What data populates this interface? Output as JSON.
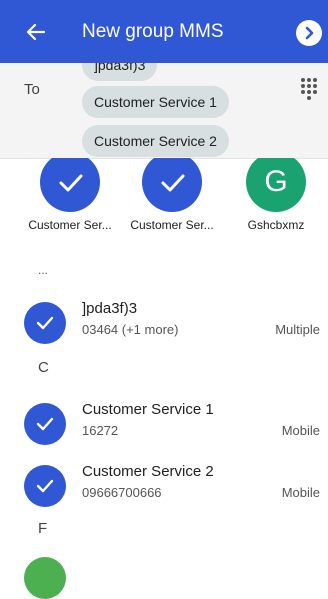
{
  "header": {
    "title": "New group MMS",
    "back_icon": "arrow-back-icon",
    "next_icon": "chevron-right-icon"
  },
  "recipients": {
    "to_label": "To",
    "chips": [
      "]pda3f)3",
      "Customer Service 1",
      "Customer Service 2"
    ],
    "dialpad_icon": "dialpad-icon"
  },
  "selected": [
    {
      "label": "Customer Ser...",
      "avatar": "check"
    },
    {
      "label": "Customer Ser...",
      "avatar": "check"
    },
    {
      "label": "Gshcbxmz",
      "avatar": "G"
    }
  ],
  "list": {
    "overflow_marker": "...",
    "sections": [
      {
        "letter": "",
        "contacts": [
          {
            "name": "]pda3f)3",
            "number": "03464 (+1 more)",
            "type": "Multiple"
          }
        ]
      },
      {
        "letter": "C",
        "contacts": [
          {
            "name": "Customer Service 1",
            "number": "16272",
            "type": "Mobile"
          },
          {
            "name": "Customer Service 2",
            "number": "09666700666",
            "type": "Mobile"
          }
        ]
      },
      {
        "letter": "F",
        "contacts": []
      }
    ]
  },
  "colors": {
    "primary": "#3057d4",
    "chip": "#d7dfe0",
    "green_avatar": "#1aa370"
  }
}
